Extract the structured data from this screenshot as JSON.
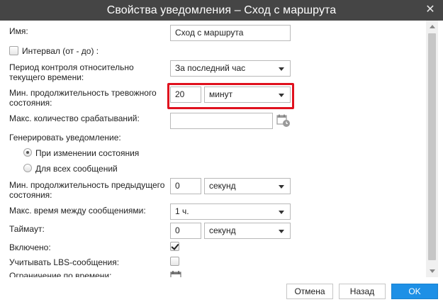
{
  "window": {
    "title": "Свойства уведомления – Сход с маршрута",
    "close_glyph": "✕"
  },
  "form": {
    "name_label": "Имя:",
    "name_value": "Сход с маршрута",
    "interval_label": "Интервал (от - до) :",
    "interval_checked": false,
    "period_label": "Период контроля относительно текущего времени:",
    "period_value": "За последний час",
    "min_duration_label": "Мин. продолжительность тревожного состояния:",
    "min_duration_value": "20",
    "min_duration_unit": "минут",
    "max_triggers_label": "Макс. количество срабатываний:",
    "max_triggers_value": "",
    "generate_label": "Генерировать уведомление:",
    "radio_on_change": "При изменении состояния",
    "radio_all_messages": "Для всех сообщений",
    "radio_selected": "on_change",
    "min_prev_duration_label": "Мин. продолжительность предыдущего состояния:",
    "min_prev_duration_value": "0",
    "min_prev_duration_unit": "секунд",
    "max_time_between_label": "Макс. время между сообщениями:",
    "max_time_between_value": "1 ч.",
    "timeout_label": "Таймаут:",
    "timeout_value": "0",
    "timeout_unit": "секунд",
    "enabled_label": "Включено:",
    "enabled_checked": true,
    "lbs_label": "Учитывать LBS-сообщения:",
    "lbs_checked": false,
    "time_limit_label": "Ограничение по времени:"
  },
  "buttons": {
    "cancel": "Отмена",
    "back": "Назад",
    "ok": "OK"
  },
  "colors": {
    "titlebar": "#454545",
    "highlight": "#e0111e",
    "ok_button": "#1e90e6"
  }
}
